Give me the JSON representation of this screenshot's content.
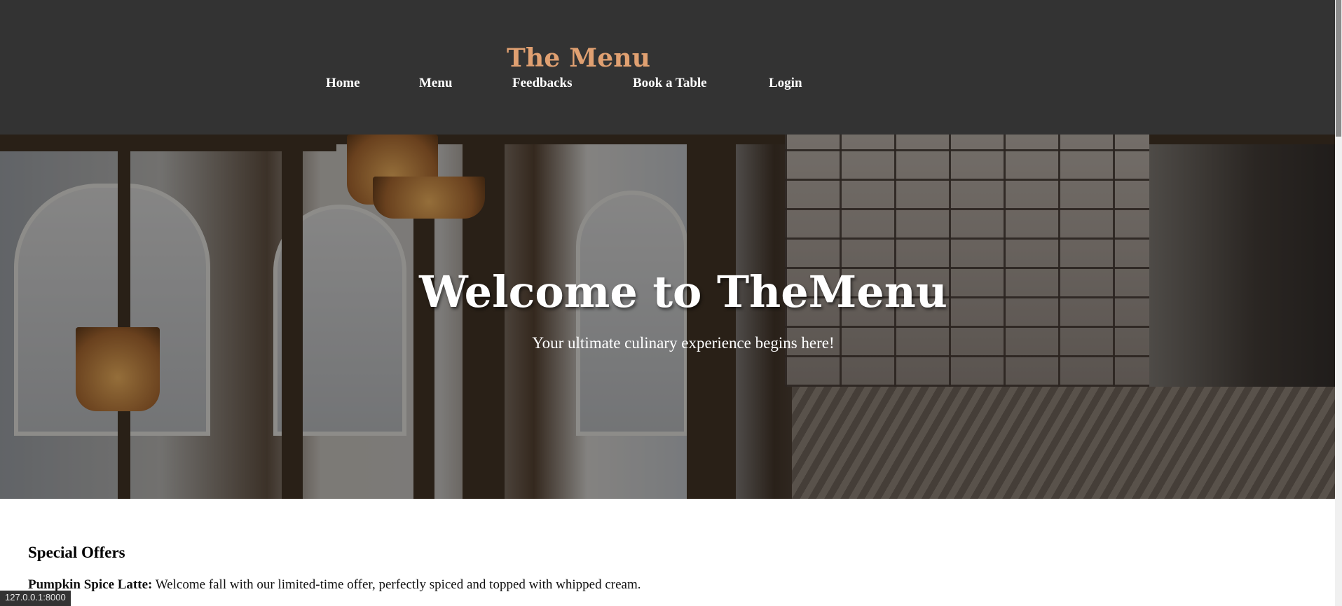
{
  "header": {
    "brand": "The Menu",
    "nav": [
      {
        "label": "Home"
      },
      {
        "label": "Menu"
      },
      {
        "label": "Feedbacks"
      },
      {
        "label": "Book a Table"
      },
      {
        "label": "Login"
      }
    ]
  },
  "hero": {
    "title": "Welcome to TheMenu",
    "subtitle": "Your ultimate culinary experience begins here!"
  },
  "offers": {
    "heading": "Special Offers",
    "items": [
      {
        "name": "Pumpkin Spice Latte:",
        "description": " Welcome fall with our limited-time offer, perfectly spiced and topped with whipped cream."
      }
    ]
  },
  "status": {
    "url": "127.0.0.1:8000"
  },
  "colors": {
    "header_bg": "#333333",
    "brand": "#e0a071",
    "nav_text": "#ffffff"
  }
}
